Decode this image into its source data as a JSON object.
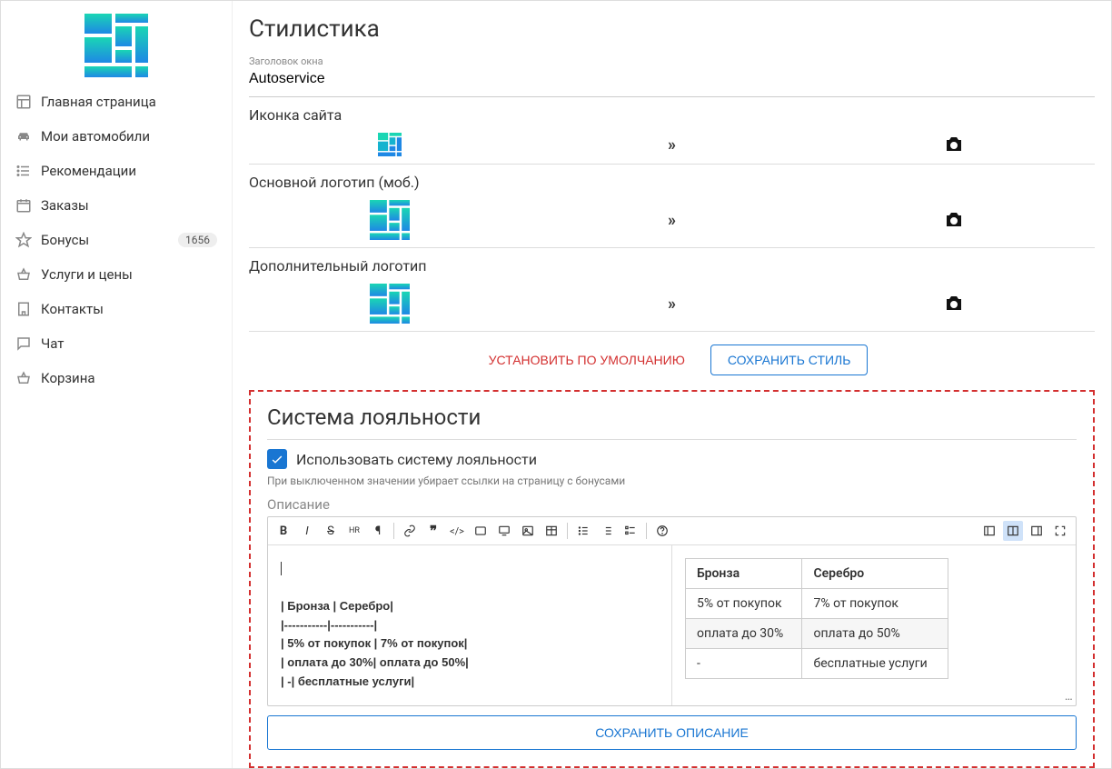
{
  "sidebar": {
    "items": [
      {
        "label": "Главная страница",
        "icon": "layout-icon",
        "badge": null
      },
      {
        "label": "Мои автомобили",
        "icon": "car-icon",
        "badge": null
      },
      {
        "label": "Рекомендации",
        "icon": "list-icon",
        "badge": null
      },
      {
        "label": "Заказы",
        "icon": "calendar-icon",
        "badge": null
      },
      {
        "label": "Бонусы",
        "icon": "star-icon",
        "badge": "1656"
      },
      {
        "label": "Услуги и цены",
        "icon": "basket-icon",
        "badge": null
      },
      {
        "label": "Контакты",
        "icon": "building-icon",
        "badge": null
      },
      {
        "label": "Чат",
        "icon": "chat-icon",
        "badge": null
      },
      {
        "label": "Корзина",
        "icon": "cart-icon",
        "badge": null
      }
    ]
  },
  "styling": {
    "title": "Стилистика",
    "window_title_label": "Заголовок окна",
    "window_title_value": "Autoservice",
    "favicon_label": "Иконка сайта",
    "logo_mobile_label": "Основной логотип (моб.)",
    "extra_logo_label": "Дополнительный логотип",
    "btn_reset": "УСТАНОВИТЬ ПО УМОЛЧАНИЮ",
    "btn_save": "СОХРАНИТЬ СТИЛЬ"
  },
  "loyalty": {
    "title": "Система лояльности",
    "checkbox_label": "Использовать систему лояльности",
    "checkbox_checked": true,
    "hint": "При выключенном значении убирает ссылки на страницу с бонусами",
    "desc_label": "Описание",
    "markdown_lines": [
      "| Бронза | Серебро|",
      "|-----------|-----------|",
      "| 5% от покупок | 7% от покупок|",
      "| оплата до 30%| оплата до 50%|",
      "| -| бесплатные услуги|"
    ],
    "table": {
      "headers": [
        "Бронза",
        "Серебро"
      ],
      "rows": [
        [
          "5% от покупок",
          "7% от покупок"
        ],
        [
          "оплата до 30%",
          "оплата до 50%"
        ],
        [
          "-",
          "бесплатные услуги"
        ]
      ]
    },
    "btn_save_desc": "СОХРАНИТЬ ОПИСАНИЕ"
  },
  "toolbar": {
    "items": [
      "B",
      "I",
      "S",
      "HR",
      "¶",
      "link",
      "quote",
      "code-block",
      "code",
      "preview",
      "image",
      "table",
      "ul",
      "ol",
      "checklist",
      "help"
    ],
    "view_items": [
      "panes-left",
      "panes-split",
      "panes-right",
      "fullscreen"
    ],
    "active_view": "panes-split"
  }
}
